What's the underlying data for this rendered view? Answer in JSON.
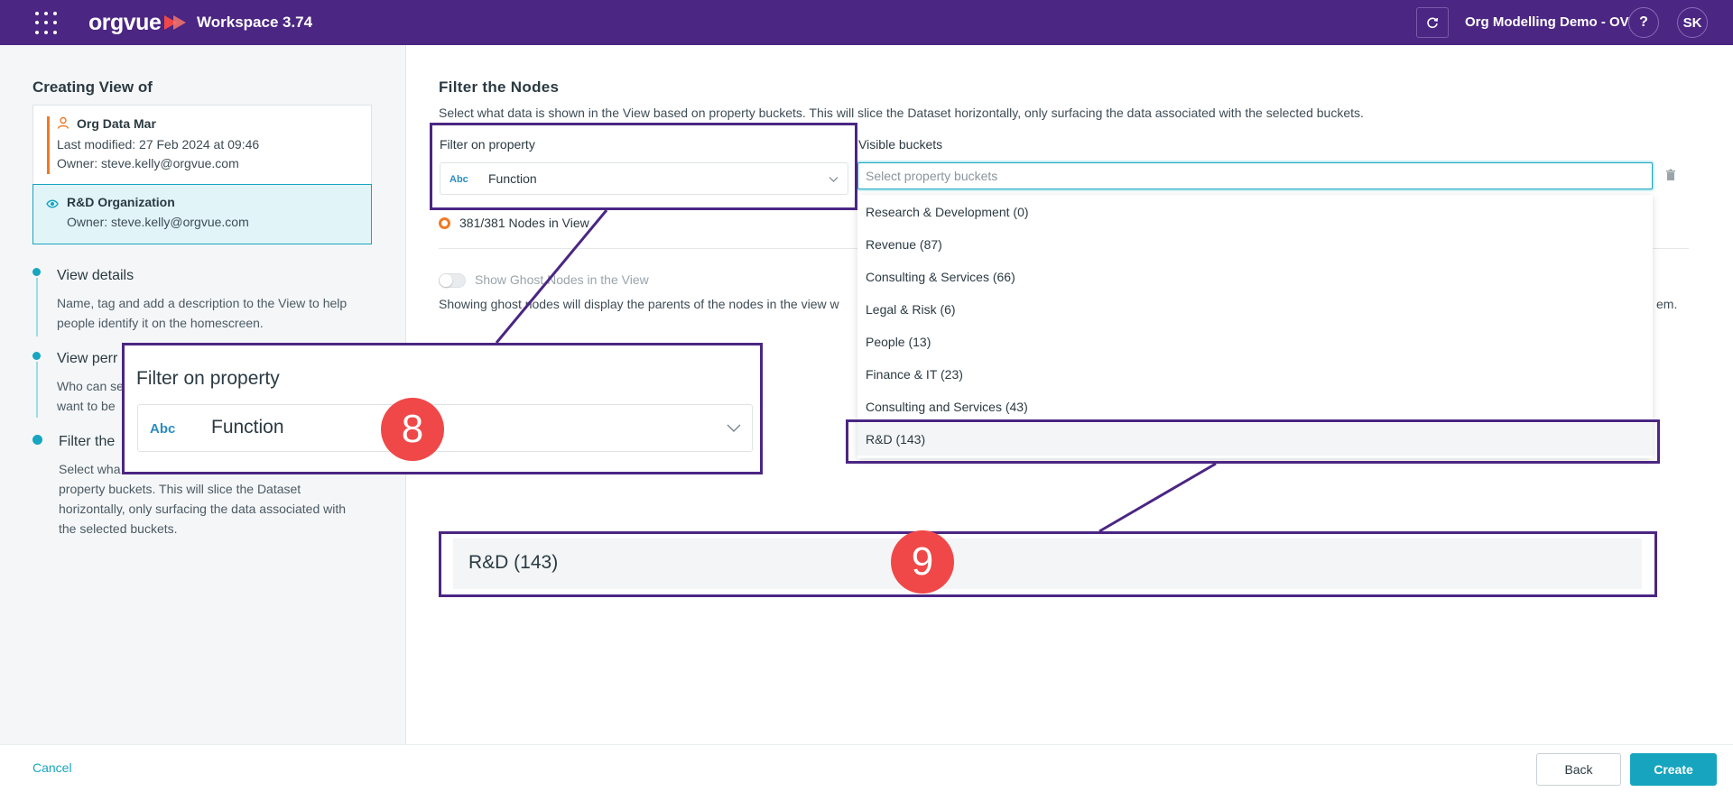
{
  "header": {
    "logo_text": "orgvue",
    "workspace_label": "Workspace",
    "version": "3.74",
    "dataset_name": "Org Modelling Demo - OV",
    "help_label": "?",
    "user_initials": "SK"
  },
  "sidebar": {
    "title": "Creating View of",
    "dataset_card": {
      "name": "Org Data Mar",
      "modified": "Last modified: 27 Feb 2024 at 09:46",
      "owner": "Owner: steve.kelly@orgvue.com"
    },
    "view_card": {
      "name": "R&D Organization",
      "owner": "Owner: steve.kelly@orgvue.com"
    },
    "steps": [
      {
        "title": "View details",
        "desc1": "Name, tag and add a description to the View to help",
        "desc2": "people identify it on the homescreen."
      },
      {
        "title": "View perr",
        "desc1": "Who can se",
        "desc2": "want to be"
      },
      {
        "title": "Filter the",
        "desc1": "Select wha",
        "desc2": "property buckets. This will slice the Dataset",
        "desc3": "horizontally, only surfacing the data associated with",
        "desc4": "the selected buckets."
      }
    ]
  },
  "main": {
    "title": "Filter the Nodes",
    "subtitle": "Select what data is shown in the View based on property buckets. This will slice the Dataset horizontally, only surfacing the data associated with the selected buckets.",
    "filter_label": "Filter on property",
    "filter_type": "Abc",
    "filter_value": "Function",
    "visible_label": "Visible buckets",
    "search_placeholder": "Select property buckets",
    "nodes_count": "381/381 Nodes in View",
    "ghost_label": "Show Ghost Nodes in the View",
    "ghost_desc": "Showing ghost nodes will display the parents of the nodes in the view w",
    "ghost_desc_end": "em.",
    "bucket_options": [
      "Research & Development (0)",
      "Revenue (87)",
      "Consulting & Services (66)",
      "Legal & Risk (6)",
      "People (13)",
      "Finance & IT (23)",
      "Consulting and Services (43)",
      "R&D (143)"
    ],
    "highlighted_option": "R&D (143)"
  },
  "callouts": {
    "step8": {
      "number": "8",
      "label": "Filter on property",
      "type": "Abc",
      "value": "Function"
    },
    "step9": {
      "number": "9",
      "value": "R&D (143)"
    },
    "border_color": "#4b2683",
    "badge_color": "#f04848"
  },
  "footer": {
    "cancel_label": "Cancel",
    "back_label": "Back",
    "create_label": "Create"
  },
  "colors": {
    "brand": "#4b2683",
    "accent": "#16a4be",
    "orange": "#f07a24"
  }
}
